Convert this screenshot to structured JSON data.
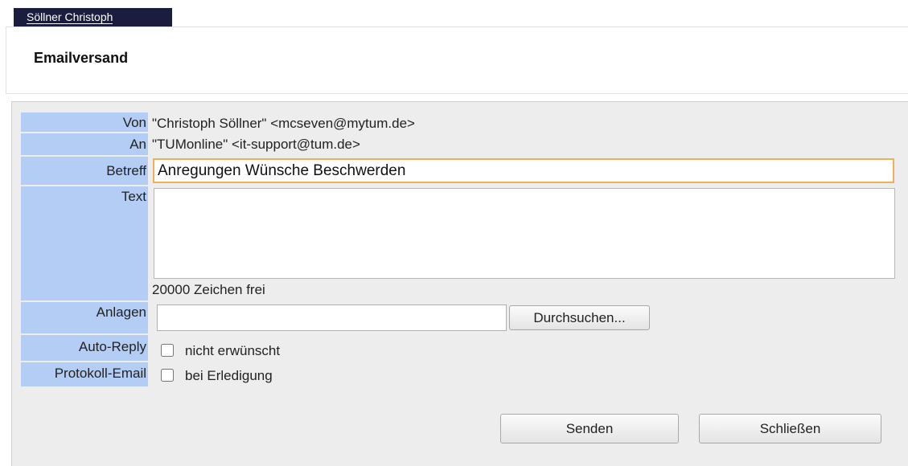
{
  "header": {
    "user_name": "Söllner Christoph",
    "page_title": "Emailversand"
  },
  "form": {
    "from_label": "Von",
    "from_value": "\"Christoph Söllner\" <mcseven@mytum.de>",
    "to_label": "An",
    "to_value": "\"TUMonline\" <it-support@tum.de>",
    "subject_label": "Betreff",
    "subject_value": "Anregungen Wünsche Beschwerden",
    "text_label": "Text",
    "text_value": "",
    "chars_left": "20000 Zeichen frei",
    "attachments_label": "Anlagen",
    "attachments_value": "",
    "browse_label": "Durchsuchen...",
    "autoreply_label": "Auto-Reply",
    "autoreply_option": "nicht erwünscht",
    "autoreply_checked": false,
    "protocol_label": "Protokoll-Email",
    "protocol_option": "bei Erledigung",
    "protocol_checked": false
  },
  "actions": {
    "send_label": "Senden",
    "close_label": "Schließen"
  },
  "colors": {
    "tab_bg": "#1b1d3f",
    "label_bg": "#b3cdf5",
    "panel_bg": "#ededed",
    "focus_border": "#f0b05a"
  }
}
